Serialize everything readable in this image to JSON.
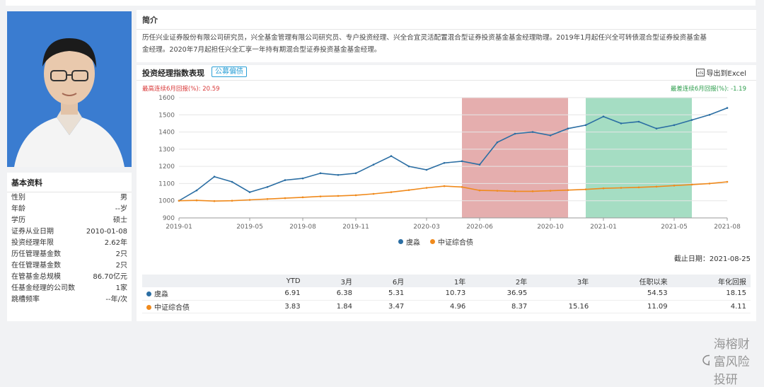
{
  "profile": {
    "section_title": "基本资料",
    "rows": [
      {
        "label": "性别",
        "value": "男"
      },
      {
        "label": "年龄",
        "value": "--岁"
      },
      {
        "label": "学历",
        "value": "硕士"
      },
      {
        "label": "证券从业日期",
        "value": "2010-01-08"
      },
      {
        "label": "投资经理年限",
        "value": "2.62年"
      },
      {
        "label": "历任管理基金数",
        "value": "2只"
      },
      {
        "label": "在任管理基金数",
        "value": "2只"
      },
      {
        "label": "在管基金总规模",
        "value": "86.70亿元"
      },
      {
        "label": "任基金经理的公司数",
        "value": "1家"
      },
      {
        "label": "跳槽频率",
        "value": "--年/次"
      }
    ]
  },
  "intro": {
    "title": "简介",
    "line1": "历任兴业证券股份有限公司研究员，兴全基金管理有限公司研究员、专户投资经理、兴全合宜灵活配置混合型证券投资基金基金经理助理。2019年1月起任兴全可转债混合型证券投资基金基",
    "line2": "金经理。2020年7月起担任兴全汇享一年持有期混合型证券投资基金基金经理。"
  },
  "panel": {
    "title": "投资经理指数表现",
    "tag": "公募偏债",
    "export": "导出到Excel",
    "best_label": "最高连续6月回报(%):",
    "best_value": "20.59",
    "worst_label": "最差连续6月回报(%):",
    "worst_value": "-1.19",
    "as_of": "截止日期：2021-08-25"
  },
  "colors": {
    "manager": "#2b6ea3",
    "benchmark": "#f08a1c",
    "best_band": "#e0a0a0",
    "worst_band": "#95d7b8"
  },
  "chart_data": {
    "type": "line",
    "ylim": [
      900,
      1600
    ],
    "yticks": [
      900,
      1000,
      1100,
      1200,
      1300,
      1400,
      1500,
      1600
    ],
    "xticks": [
      "2019-01",
      "2019-05",
      "2019-08",
      "2019-11",
      "2020-03",
      "2020-06",
      "2020-10",
      "2021-01",
      "2021-05",
      "2021-08"
    ],
    "x": [
      "2019-01",
      "2019-02",
      "2019-03",
      "2019-04",
      "2019-05",
      "2019-06",
      "2019-07",
      "2019-08",
      "2019-09",
      "2019-10",
      "2019-11",
      "2019-12",
      "2020-01",
      "2020-02",
      "2020-03",
      "2020-04",
      "2020-05",
      "2020-06",
      "2020-07",
      "2020-08",
      "2020-09",
      "2020-10",
      "2020-11",
      "2020-12",
      "2021-01",
      "2021-02",
      "2021-03",
      "2021-04",
      "2021-05",
      "2021-06",
      "2021-07",
      "2021-08"
    ],
    "series": [
      {
        "name": "虞淼",
        "values": [
          1000,
          1060,
          1140,
          1110,
          1050,
          1080,
          1120,
          1130,
          1160,
          1150,
          1160,
          1210,
          1260,
          1200,
          1180,
          1220,
          1230,
          1210,
          1340,
          1390,
          1400,
          1380,
          1420,
          1440,
          1490,
          1450,
          1460,
          1420,
          1440,
          1470,
          1500,
          1540
        ]
      },
      {
        "name": "中证综合债",
        "values": [
          1000,
          1002,
          998,
          1000,
          1005,
          1010,
          1015,
          1020,
          1025,
          1028,
          1032,
          1040,
          1050,
          1062,
          1075,
          1085,
          1080,
          1060,
          1058,
          1055,
          1055,
          1058,
          1062,
          1066,
          1072,
          1075,
          1078,
          1082,
          1088,
          1094,
          1100,
          1110
        ]
      }
    ],
    "bands": [
      {
        "label": "最高连续6月回报",
        "start": "2020-05",
        "end": "2020-11"
      },
      {
        "label": "最差连续6月回报",
        "start": "2020-12",
        "end": "2021-06"
      }
    ]
  },
  "returns_table": {
    "headers": [
      "",
      "YTD",
      "3月",
      "6月",
      "1年",
      "2年",
      "3年",
      "任职以来",
      "年化回报"
    ],
    "rows": [
      {
        "name": "虞淼",
        "values": [
          "6.91",
          "6.38",
          "5.31",
          "10.73",
          "36.95",
          "",
          "54.53",
          "18.15"
        ]
      },
      {
        "name": "中证综合债",
        "values": [
          "3.83",
          "1.84",
          "3.47",
          "4.96",
          "8.37",
          "15.16",
          "11.09",
          "4.11"
        ]
      }
    ]
  },
  "watermark": "海榕财富风险投研"
}
